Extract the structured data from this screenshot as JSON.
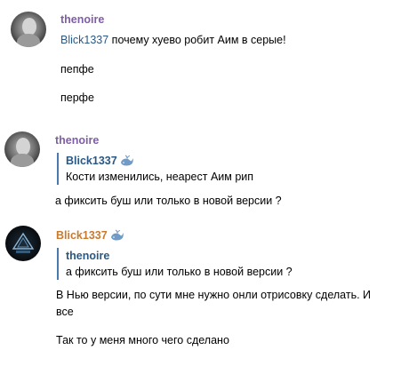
{
  "messages": [
    {
      "author": "thenoire",
      "author_color": "#7e5ea6",
      "mention": "Blick1337",
      "line1_rest": " почему хуево робит Аим в серые!",
      "line2": "пепфе",
      "line3": "перфе"
    },
    {
      "author": "thenoire",
      "author_color": "#7e5ea6",
      "quote_author": "Blick1337",
      "quote_badge_icon": "whale-icon",
      "quote_text": "Кости изменились, неарест Аим рип",
      "text": "а фиксить буш или только в новой версии ?"
    },
    {
      "author": "Blick1337",
      "author_color": "#c87a2e",
      "author_badge_icon": "whale-icon",
      "quote_author": "thenoire",
      "quote_text": "а фиксить буш или только в новой версии ?",
      "text": "В Нью версии, по сути мне нужно онли отрисовку сделать. И все",
      "text2": "Так то у меня много чего сделано"
    }
  ],
  "colors": {
    "link": "#2a5885",
    "quote_bar": "#4a7aad",
    "whale": "#6f9bc6"
  }
}
